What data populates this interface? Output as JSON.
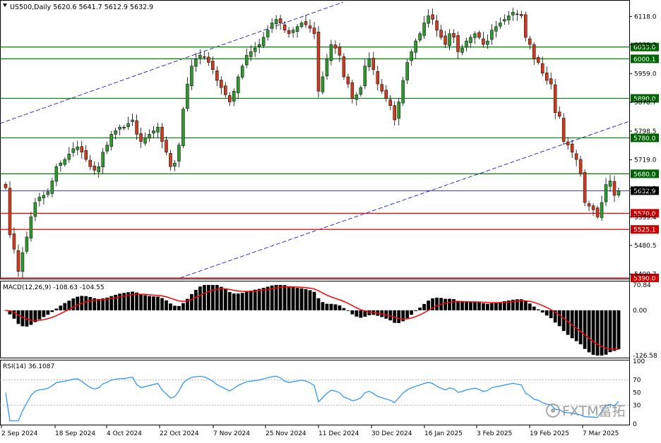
{
  "header": {
    "symbol_line": "US500,Daily  5620.6 5641.7 5612.9 5632.9",
    "toggle_icon": "triangle-down-icon"
  },
  "colors": {
    "up": "#2e9a2e",
    "down": "#cc3d1f",
    "support": "#ff0000",
    "resistance": "#008000",
    "channel": "#0000cc",
    "current": "#000080",
    "macd_signal": "#ff0000",
    "rsi_line": "#1e90ff",
    "box_green": "#006400",
    "box_red": "#cc0000",
    "box_current": "#000000"
  },
  "chart_data": [
    {
      "type": "candlestick",
      "title": "US500,Daily",
      "ohlc_last": {
        "open": 5620.6,
        "high": 5641.7,
        "low": 5612.9,
        "close": 5632.9
      },
      "ylim": [
        5390.0,
        6160.0
      ],
      "y_ticks": [
        6118.0,
        6039.3,
        5959.0,
        5878.7,
        5798.5,
        5719.0,
        5638.7,
        5559.4,
        5480.5,
        5400.7
      ],
      "x_ticks": [
        "2 Sep 2024",
        "18 Sep 2024",
        "4 Oct 2024",
        "22 Oct 2024",
        "7 Nov 2024",
        "25 Nov 2024",
        "11 Dec 2024",
        "30 Dec 2024",
        "16 Jan 2025",
        "3 Feb 2025",
        "19 Feb 2025",
        "7 Mar 2025"
      ],
      "horizontal_levels": [
        {
          "value": 6033.0,
          "label": "6033.0",
          "kind": "resistance"
        },
        {
          "value": 6000.1,
          "label": "6000.1",
          "kind": "resistance"
        },
        {
          "value": 5890.0,
          "label": "5890.0",
          "kind": "resistance"
        },
        {
          "value": 5780.0,
          "label": "5780.0",
          "kind": "resistance"
        },
        {
          "value": 5680.0,
          "label": "5680.0",
          "kind": "resistance"
        },
        {
          "value": 5632.9,
          "label": "5632.9",
          "kind": "current"
        },
        {
          "value": 5570.0,
          "label": "5570.0",
          "kind": "support"
        },
        {
          "value": 5525.1,
          "label": "5525.1",
          "kind": "support"
        },
        {
          "value": 5390.0,
          "label": "5390.0",
          "kind": "support"
        }
      ],
      "closes": [
        5641,
        5510,
        5470,
        5408,
        5460,
        5504,
        5560,
        5600,
        5615,
        5620,
        5630,
        5660,
        5700,
        5710,
        5720,
        5735,
        5750,
        5755,
        5740,
        5720,
        5700,
        5690,
        5700,
        5740,
        5760,
        5790,
        5800,
        5810,
        5810,
        5820,
        5830,
        5790,
        5770,
        5780,
        5790,
        5800,
        5810,
        5770,
        5740,
        5700,
        5710,
        5760,
        5860,
        5930,
        5980,
        6000,
        6010,
        6005,
        5990,
        5970,
        5940,
        5920,
        5900,
        5880,
        5910,
        5950,
        5980,
        6010,
        6020,
        6030,
        6040,
        6060,
        6080,
        6100,
        6110,
        6100,
        6080,
        6070,
        6080,
        6090,
        6100,
        6095,
        6085,
        6070,
        5910,
        5950,
        6000,
        6040,
        6030,
        6010,
        5950,
        5930,
        5890,
        5900,
        5920,
        5980,
        6000,
        5970,
        5930,
        5910,
        5890,
        5870,
        5830,
        5880,
        5940,
        5990,
        6020,
        6050,
        6070,
        6100,
        6120,
        6110,
        6080,
        6060,
        6040,
        6070,
        6060,
        6020,
        6030,
        6050,
        6060,
        6070,
        6060,
        6040,
        6050,
        6080,
        6090,
        6100,
        6110,
        6120,
        6130,
        6125,
        6120,
        6060,
        6040,
        6000,
        5990,
        5960,
        5940,
        5930,
        5850,
        5840,
        5770,
        5760,
        5740,
        5720,
        5680,
        5600,
        5590,
        5580,
        5560,
        5600,
        5650,
        5660,
        5620,
        5632.9
      ],
      "rsi": {
        "label": "RSI(14) 36.1087",
        "period": 14,
        "value": 36.1087,
        "ylim": [
          0,
          100
        ],
        "ticks": [
          100,
          70,
          50,
          30,
          0
        ]
      },
      "macd": {
        "label": "MACD(12,26,9) -108.63 -104.55",
        "params": [
          12,
          26,
          9
        ],
        "macd": -108.63,
        "signal": -104.55,
        "ylim": [
          -126.58,
          70.84
        ],
        "ticks": [
          70.84,
          0.0,
          -126.58
        ],
        "tick_labels": [
          "70.84",
          "0.00",
          "-126.58"
        ]
      }
    }
  ],
  "watermark": {
    "text": "FXTM富拓"
  }
}
